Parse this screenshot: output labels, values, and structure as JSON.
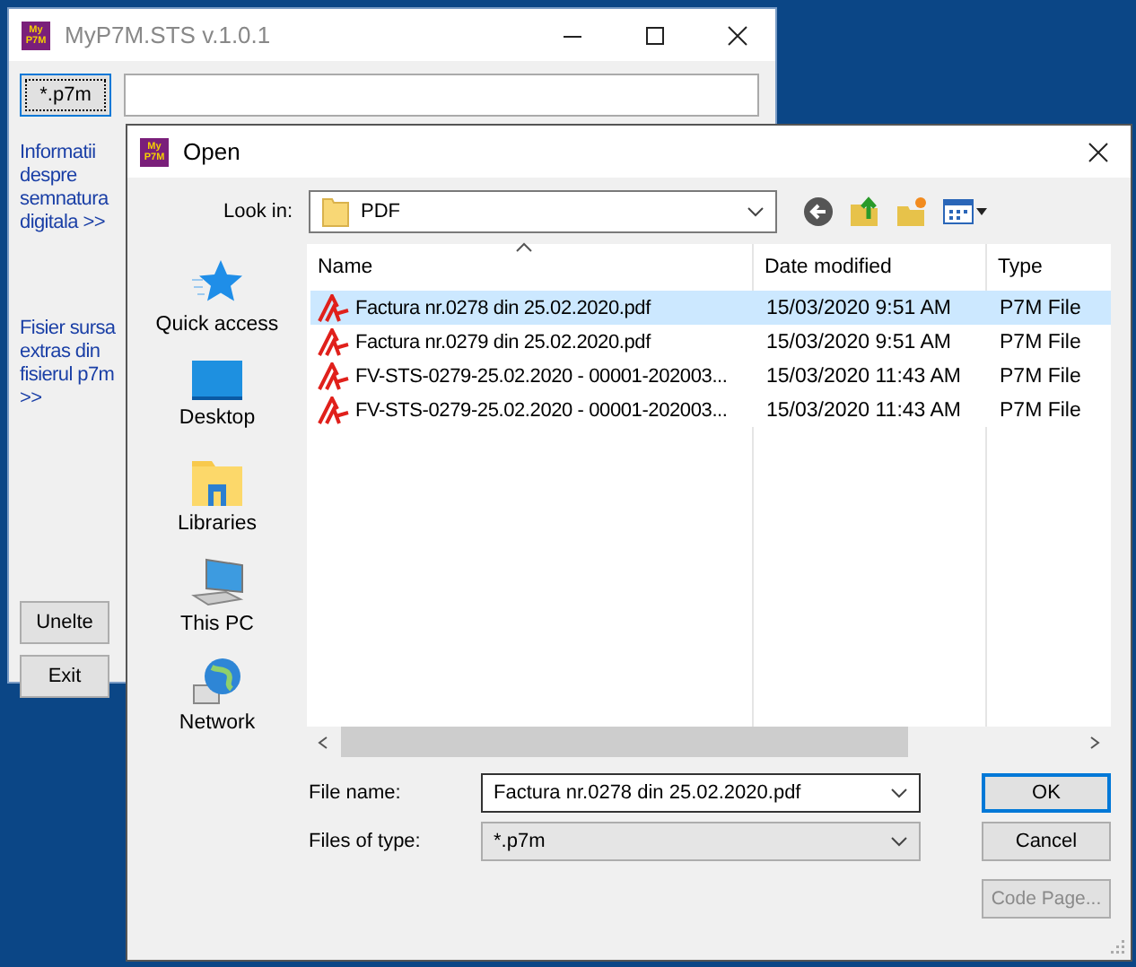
{
  "main_window": {
    "icon": [
      "My",
      "P7M"
    ],
    "title": "MyP7M.STS v.1.0.1",
    "file_button": "*.p7m",
    "links": [
      "Informatii despre semnatura digitala >>",
      "Fisier sursa extras din fisierul p7m >>"
    ],
    "buttons": [
      "Unelte",
      "Exit"
    ]
  },
  "dialog": {
    "icon": [
      "My",
      "P7M"
    ],
    "title": "Open",
    "look_in_label": "Look in:",
    "look_in_value": "PDF",
    "places": [
      {
        "kind": "quick",
        "label": "Quick access"
      },
      {
        "kind": "desktop",
        "label": "Desktop"
      },
      {
        "kind": "libraries",
        "label": "Libraries"
      },
      {
        "kind": "pc",
        "label": "This PC"
      },
      {
        "kind": "network",
        "label": "Network"
      }
    ],
    "columns": [
      "Name",
      "Date modified",
      "Type"
    ],
    "files": [
      {
        "name": "Factura nr.0278 din 25.02.2020.pdf",
        "date": "15/03/2020 9:51 AM",
        "type": "P7M File",
        "selected": true
      },
      {
        "name": "Factura nr.0279 din 25.02.2020.pdf",
        "date": "15/03/2020 9:51 AM",
        "type": "P7M File",
        "selected": false
      },
      {
        "name": "FV-STS-0279-25.02.2020 - 00001-202003...",
        "date": "15/03/2020 11:43 AM",
        "type": "P7M File",
        "selected": false
      },
      {
        "name": "FV-STS-0279-25.02.2020 - 00001-202003...",
        "date": "15/03/2020 11:43 AM",
        "type": "P7M File",
        "selected": false
      }
    ],
    "file_name_label": "File name:",
    "file_name_value": "Factura nr.0278 din 25.02.2020.pdf",
    "file_type_label": "Files of type:",
    "file_type_value": "*.p7m",
    "buttons": [
      {
        "label": "OK",
        "default": true,
        "disabled": false
      },
      {
        "label": "Cancel",
        "default": false,
        "disabled": false
      },
      {
        "label": "Code Page...",
        "default": false,
        "disabled": true
      }
    ]
  }
}
